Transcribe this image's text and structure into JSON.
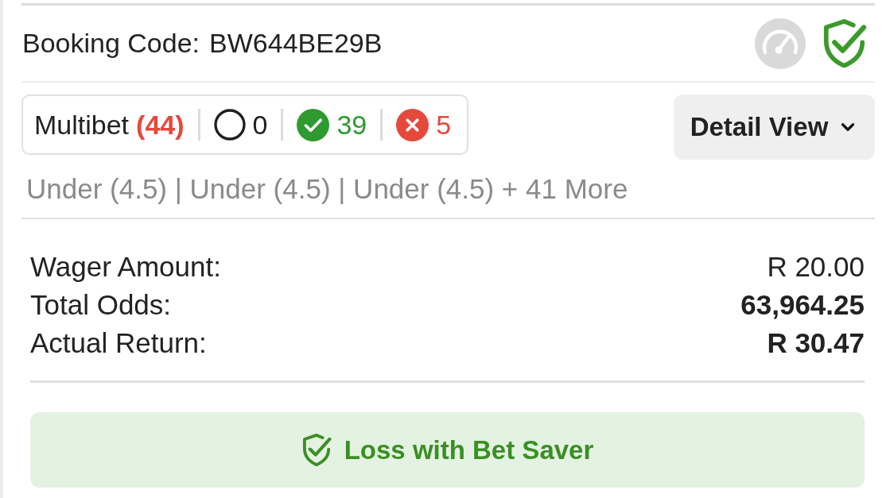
{
  "booking": {
    "label": "Booking Code:",
    "code": "BW644BE29B"
  },
  "summary": {
    "label": "Multibet",
    "count": "(44)",
    "stats": [
      {
        "kind": "open",
        "count": "0"
      },
      {
        "kind": "won",
        "count": "39"
      },
      {
        "kind": "lost",
        "count": "5"
      }
    ]
  },
  "view_menu": {
    "label": "Detail View"
  },
  "selections_preview": "Under (4.5) | Under (4.5) | Under (4.5) + 41 More",
  "totals": [
    {
      "label": "Wager Amount:",
      "value": "R 20.00",
      "bold": false
    },
    {
      "label": "Total Odds:",
      "value": "63,964.25",
      "bold": true
    },
    {
      "label": "Actual Return:",
      "value": "R 30.47",
      "bold": true
    }
  ],
  "outcome_button": {
    "label": "Loss with Bet Saver"
  }
}
